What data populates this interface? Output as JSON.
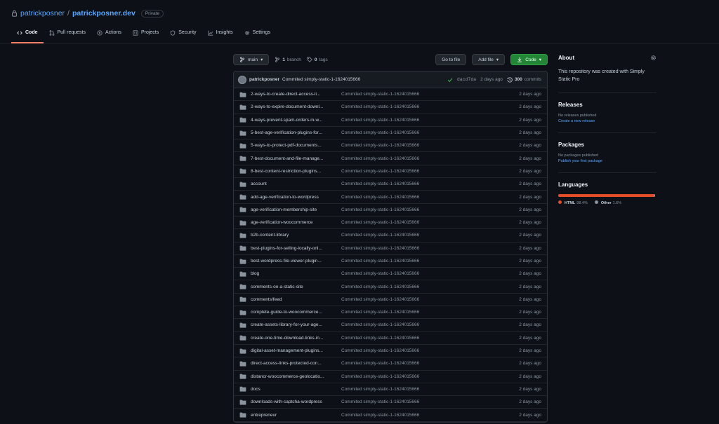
{
  "repo": {
    "owner": "patrickposner",
    "slash": "/",
    "name": "patrickposner.dev",
    "visibility": "Private"
  },
  "tabs": [
    {
      "label": "Code",
      "icon": "code-icon"
    },
    {
      "label": "Pull requests",
      "icon": "pull-request-icon"
    },
    {
      "label": "Actions",
      "icon": "play-icon"
    },
    {
      "label": "Projects",
      "icon": "project-icon"
    },
    {
      "label": "Security",
      "icon": "shield-icon"
    },
    {
      "label": "Insights",
      "icon": "graph-icon"
    },
    {
      "label": "Settings",
      "icon": "gear-icon"
    }
  ],
  "toolbar": {
    "branch_name": "main",
    "branch_count": "1",
    "branch_label": "branch",
    "tag_count": "0",
    "tag_label": "tags",
    "goto_file": "Go to file",
    "add_file": "Add file",
    "code": "Code"
  },
  "commit": {
    "author": "patrickposner",
    "message": "Commited simply-static-1-1624015666",
    "sha": "dacd7da",
    "date": "2 days ago",
    "count": "300",
    "count_label": "commits"
  },
  "files": [
    {
      "name": "2-ways-to-create-direct-access-li...",
      "message": "Commited simply-static-1-1624015666",
      "date": "2 days ago"
    },
    {
      "name": "2-ways-to-expire-document-downl...",
      "message": "Commited simply-static-1-1624015666",
      "date": "2 days ago"
    },
    {
      "name": "4-ways-prevent-spam-orders-in-w...",
      "message": "Commited simply-static-1-1624015666",
      "date": "2 days ago"
    },
    {
      "name": "5-best-age-verification-plugins-for...",
      "message": "Commited simply-static-1-1624015666",
      "date": "2 days ago"
    },
    {
      "name": "5-ways-to-protect-pdf-documents...",
      "message": "Commited simply-static-1-1624015666",
      "date": "2 days ago"
    },
    {
      "name": "7-best-document-and-file-manage...",
      "message": "Commited simply-static-1-1624015666",
      "date": "2 days ago"
    },
    {
      "name": "8-best-content-restriction-plugins...",
      "message": "Commited simply-static-1-1624015666",
      "date": "2 days ago"
    },
    {
      "name": "account",
      "message": "Commited simply-static-1-1624015666",
      "date": "2 days ago"
    },
    {
      "name": "add-age-verification-to-wordpress",
      "message": "Commited simply-static-1-1624015666",
      "date": "2 days ago"
    },
    {
      "name": "age-verification-membership-site",
      "message": "Commited simply-static-1-1624015666",
      "date": "2 days ago"
    },
    {
      "name": "age-verification-woocommerce",
      "message": "Commited simply-static-1-1624015666",
      "date": "2 days ago"
    },
    {
      "name": "b2b-content-library",
      "message": "Commited simply-static-1-1624015666",
      "date": "2 days ago"
    },
    {
      "name": "best-plugins-for-selling-locally-onl...",
      "message": "Commited simply-static-1-1624015666",
      "date": "2 days ago"
    },
    {
      "name": "best-wordpress-file-viewer-plugin...",
      "message": "Commited simply-static-1-1624015666",
      "date": "2 days ago"
    },
    {
      "name": "blog",
      "message": "Commited simply-static-1-1624015666",
      "date": "2 days ago"
    },
    {
      "name": "comments-on-a-static-site",
      "message": "Commited simply-static-1-1624015666",
      "date": "2 days ago"
    },
    {
      "name": "comments/feed",
      "message": "Commited simply-static-1-1624015666",
      "date": "2 days ago"
    },
    {
      "name": "complete-guide-to-woocommerce...",
      "message": "Commited simply-static-1-1624015666",
      "date": "2 days ago"
    },
    {
      "name": "create-assets-library-for-your-age...",
      "message": "Commited simply-static-1-1624015666",
      "date": "2 days ago"
    },
    {
      "name": "create-one-time-download-links-in...",
      "message": "Commited simply-static-1-1624015666",
      "date": "2 days ago"
    },
    {
      "name": "digital-asset-management-plugins...",
      "message": "Commited simply-static-1-1624015666",
      "date": "2 days ago"
    },
    {
      "name": "direct-access-links-protected-con...",
      "message": "Commited simply-static-1-1624015666",
      "date": "2 days ago"
    },
    {
      "name": "distancr-woocommerce-geolocatio...",
      "message": "Commited simply-static-1-1624015666",
      "date": "2 days ago"
    },
    {
      "name": "docs",
      "message": "Commited simply-static-1-1624015666",
      "date": "2 days ago"
    },
    {
      "name": "downloads-with-captcha-wordpress",
      "message": "Commited simply-static-1-1624015666",
      "date": "2 days ago"
    },
    {
      "name": "entrepreneur",
      "message": "Commited simply-static-1-1624015666",
      "date": "2 days ago"
    }
  ],
  "sidebar": {
    "about_title": "About",
    "about_desc": "This repository was created with Simply Static Pro",
    "releases_title": "Releases",
    "releases_none": "No releases published",
    "releases_link": "Create a new release",
    "packages_title": "Packages",
    "packages_none": "No packages published",
    "packages_link": "Publish your first package",
    "languages_title": "Languages",
    "languages": [
      {
        "name": "HTML",
        "percent": "98.4%",
        "color": "#e34c26"
      },
      {
        "name": "Other",
        "percent": "1.6%",
        "color": "#8b949e"
      }
    ]
  },
  "colors": {
    "background": "#0d1117",
    "link": "#58a6ff",
    "accent_tab": "#f78166",
    "code_button": "#238636"
  }
}
